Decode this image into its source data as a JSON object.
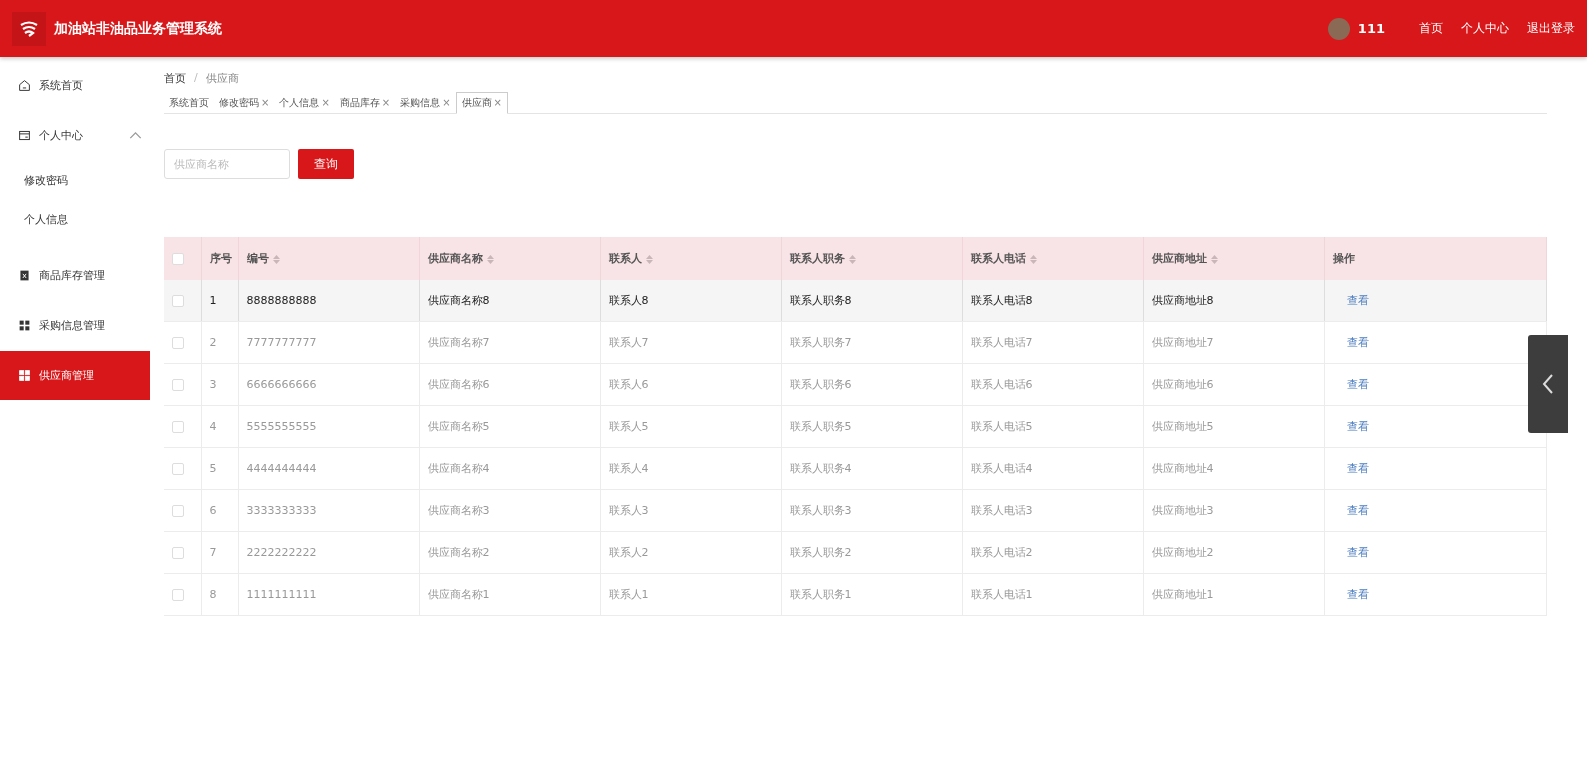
{
  "header": {
    "title": "加油站非油品业务管理系统",
    "username": "111",
    "links": [
      "首页",
      "个人中心",
      "退出登录"
    ]
  },
  "sidebar": {
    "items": [
      {
        "label": "系统首页",
        "selected": false
      },
      {
        "label": "个人中心",
        "selected": false,
        "expanded": true,
        "children": [
          {
            "label": "修改密码",
            "selected": false
          },
          {
            "label": "个人信息",
            "selected": false
          }
        ]
      },
      {
        "label": "商品库存管理",
        "selected": false
      },
      {
        "label": "采购信息管理",
        "selected": false
      },
      {
        "label": "供应商管理",
        "selected": true
      }
    ]
  },
  "breadcrumb": {
    "items": [
      "首页",
      "供应商"
    ],
    "separator": "/"
  },
  "tabs": [
    {
      "label": "系统首页",
      "selected": false
    },
    {
      "label": "修改密码",
      "close": "×",
      "selected": false
    },
    {
      "label": "个人信息",
      "close": "×",
      "selected": false
    },
    {
      "label": "商品库存",
      "close": "×",
      "selected": false
    },
    {
      "label": "采购信息",
      "close": "×",
      "selected": false
    },
    {
      "label": "供应商",
      "close": "×",
      "selected": true
    }
  ],
  "search": {
    "placeholder": "供应商名称",
    "button": "查询"
  },
  "table": {
    "select_all_checked": false,
    "columns": [
      {
        "label": "序号",
        "sortable": false
      },
      {
        "label": "编号",
        "sortable": true
      },
      {
        "label": "供应商名称",
        "sortable": true
      },
      {
        "label": "联系人",
        "sortable": true
      },
      {
        "label": "联系人职务",
        "sortable": true
      },
      {
        "label": "联系人电话",
        "sortable": true
      },
      {
        "label": "供应商地址",
        "sortable": true
      },
      {
        "label": "操作",
        "sortable": false
      }
    ],
    "rows": [
      {
        "hovered": true,
        "checked": false,
        "cells": [
          "1",
          "8888888888",
          "供应商名称8",
          "联系人8",
          "联系人职务8",
          "联系人电话8",
          "供应商地址8"
        ],
        "action": "查看"
      },
      {
        "hovered": false,
        "checked": false,
        "cells": [
          "2",
          "7777777777",
          "供应商名称7",
          "联系人7",
          "联系人职务7",
          "联系人电话7",
          "供应商地址7"
        ],
        "action": "查看"
      },
      {
        "hovered": false,
        "checked": false,
        "cells": [
          "3",
          "6666666666",
          "供应商名称6",
          "联系人6",
          "联系人职务6",
          "联系人电话6",
          "供应商地址6"
        ],
        "action": "查看"
      },
      {
        "hovered": false,
        "checked": false,
        "cells": [
          "4",
          "5555555555",
          "供应商名称5",
          "联系人5",
          "联系人职务5",
          "联系人电话5",
          "供应商地址5"
        ],
        "action": "查看"
      },
      {
        "hovered": false,
        "checked": false,
        "cells": [
          "5",
          "4444444444",
          "供应商名称4",
          "联系人4",
          "联系人职务4",
          "联系人电话4",
          "供应商地址4"
        ],
        "action": "查看"
      },
      {
        "hovered": false,
        "checked": false,
        "cells": [
          "6",
          "3333333333",
          "供应商名称3",
          "联系人3",
          "联系人职务3",
          "联系人电话3",
          "供应商地址3"
        ],
        "action": "查看"
      },
      {
        "hovered": false,
        "checked": false,
        "cells": [
          "7",
          "2222222222",
          "供应商名称2",
          "联系人2",
          "联系人职务2",
          "联系人电话2",
          "供应商地址2"
        ],
        "action": "查看"
      },
      {
        "hovered": false,
        "checked": false,
        "cells": [
          "8",
          "1111111111",
          "供应商名称1",
          "联系人1",
          "联系人职务1",
          "联系人电话1",
          "供应商地址1"
        ],
        "action": "查看"
      }
    ]
  }
}
